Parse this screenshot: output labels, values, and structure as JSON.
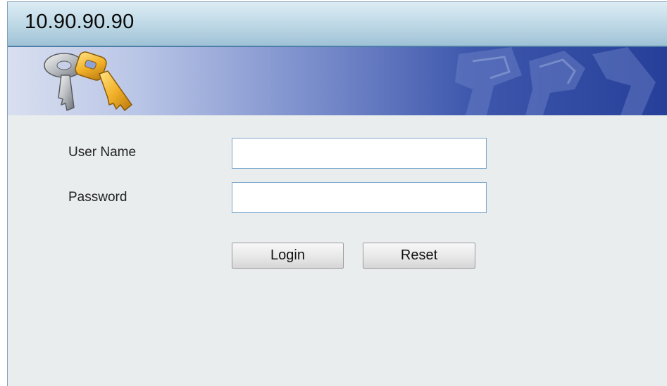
{
  "window": {
    "title": "10.90.90.90"
  },
  "banner": {
    "icon": "keys-icon",
    "watermark_icon": "keys-watermark-icon"
  },
  "login_form": {
    "username_label": "User Name",
    "username_value": "",
    "password_label": "Password",
    "password_value": "",
    "login_button_label": "Login",
    "reset_button_label": "Reset"
  },
  "colors": {
    "title_bar": "#c2dbe8",
    "banner_dark": "#263f99",
    "form_background": "#e9eded",
    "input_border": "#7aa6cc"
  }
}
